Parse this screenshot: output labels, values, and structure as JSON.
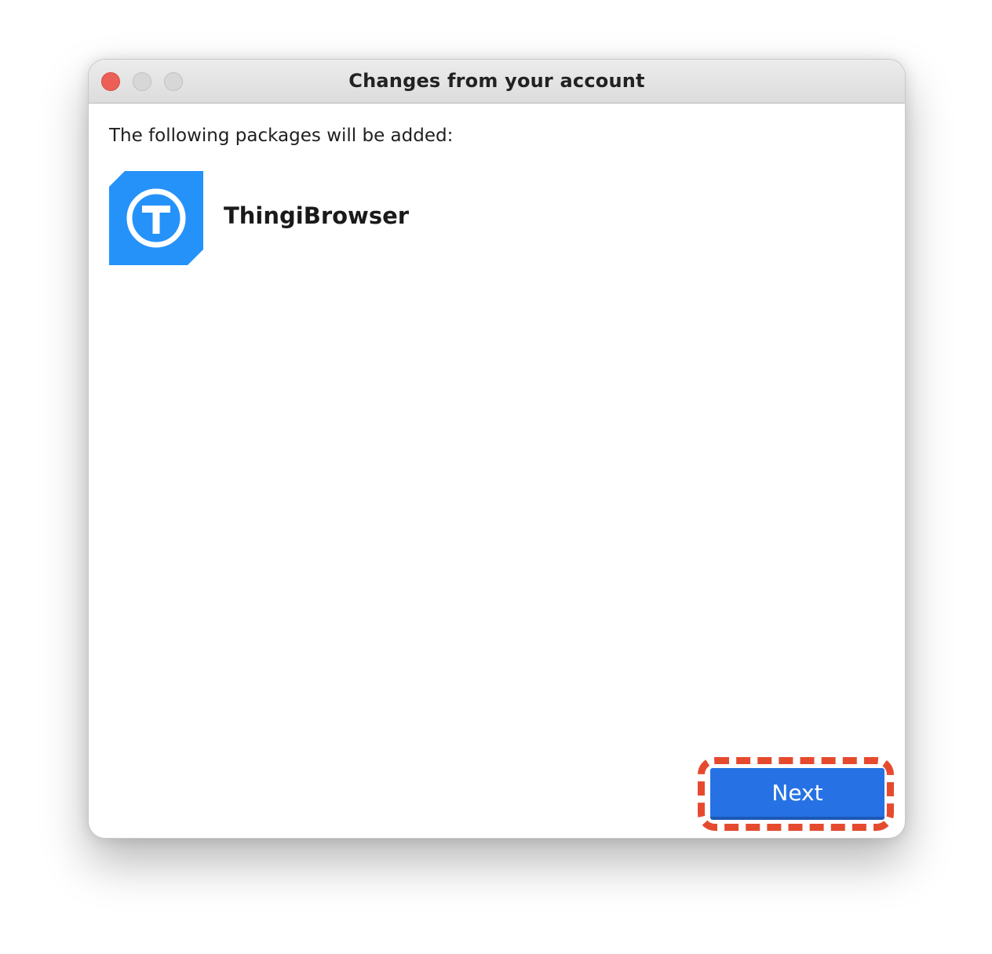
{
  "window": {
    "title": "Changes from your account"
  },
  "content": {
    "intro_text": "The following packages will be added:",
    "packages": [
      {
        "name": "ThingiBrowser",
        "icon": "thingiverse-logo-icon"
      }
    ]
  },
  "footer": {
    "next_label": "Next"
  },
  "colors": {
    "accent": "#2672e4",
    "icon_bg": "#2592f9",
    "highlight": "#e64a2e",
    "close": "#ec5f57"
  }
}
